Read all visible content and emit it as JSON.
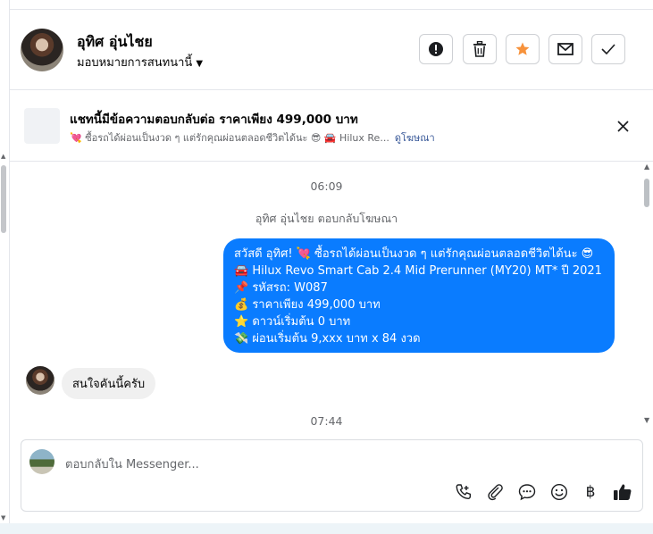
{
  "header": {
    "name": "อุทิศ อุ่นไชย",
    "assign_label": "มอบหมายการสนทนานี้",
    "actions": [
      "report-icon",
      "trash-icon",
      "star-icon",
      "mail-icon",
      "check-icon"
    ],
    "star_color": "#f7923b"
  },
  "ad": {
    "title": "แชทนี้มีข้อความตอบกลับต่อ ราคาเพียง 499,000 บาท",
    "subtitle": "💘 ซื้อรถได้ผ่อนเป็นงวด ๆ แต่รักคุณผ่อนตลอดชีวิตได้นะ 😎 🚘 Hilux Re...",
    "link": "ดูโฆษณา"
  },
  "messages": {
    "time1": "06:09",
    "system": "อุทิศ อุ่นไชย ตอบกลับโฆษณา",
    "outgoing": [
      "สวัสดี อุทิศ! 💘 ซื้อรถได้ผ่อนเป็นงวด ๆ แต่รักคุณผ่อนตลอดชีวิตได้นะ 😎",
      "🚘 Hilux Revo Smart Cab 2.4 Mid Prerunner (MY20) MT* ปี 2021",
      "📌 รหัสรถ: W087",
      "💰 ราคาเพียง 499,000 บาท",
      "⭐ ดาวน์เริ่มต้น 0 บาท",
      "💸 ผ่อนเริ่มต้น 9,xxx บาท x 84 งวด"
    ],
    "incoming": "สนใจคันนี้ครับ",
    "time2": "07:44",
    "bubble_color": "#0a7cff"
  },
  "composer": {
    "placeholder": "ตอบกลับใน Messenger...",
    "tools": [
      "call-icon",
      "attach-icon",
      "quick-reply-icon",
      "emoji-icon",
      "baht-icon",
      "thumbs-up-icon"
    ],
    "baht_symbol": "฿"
  }
}
